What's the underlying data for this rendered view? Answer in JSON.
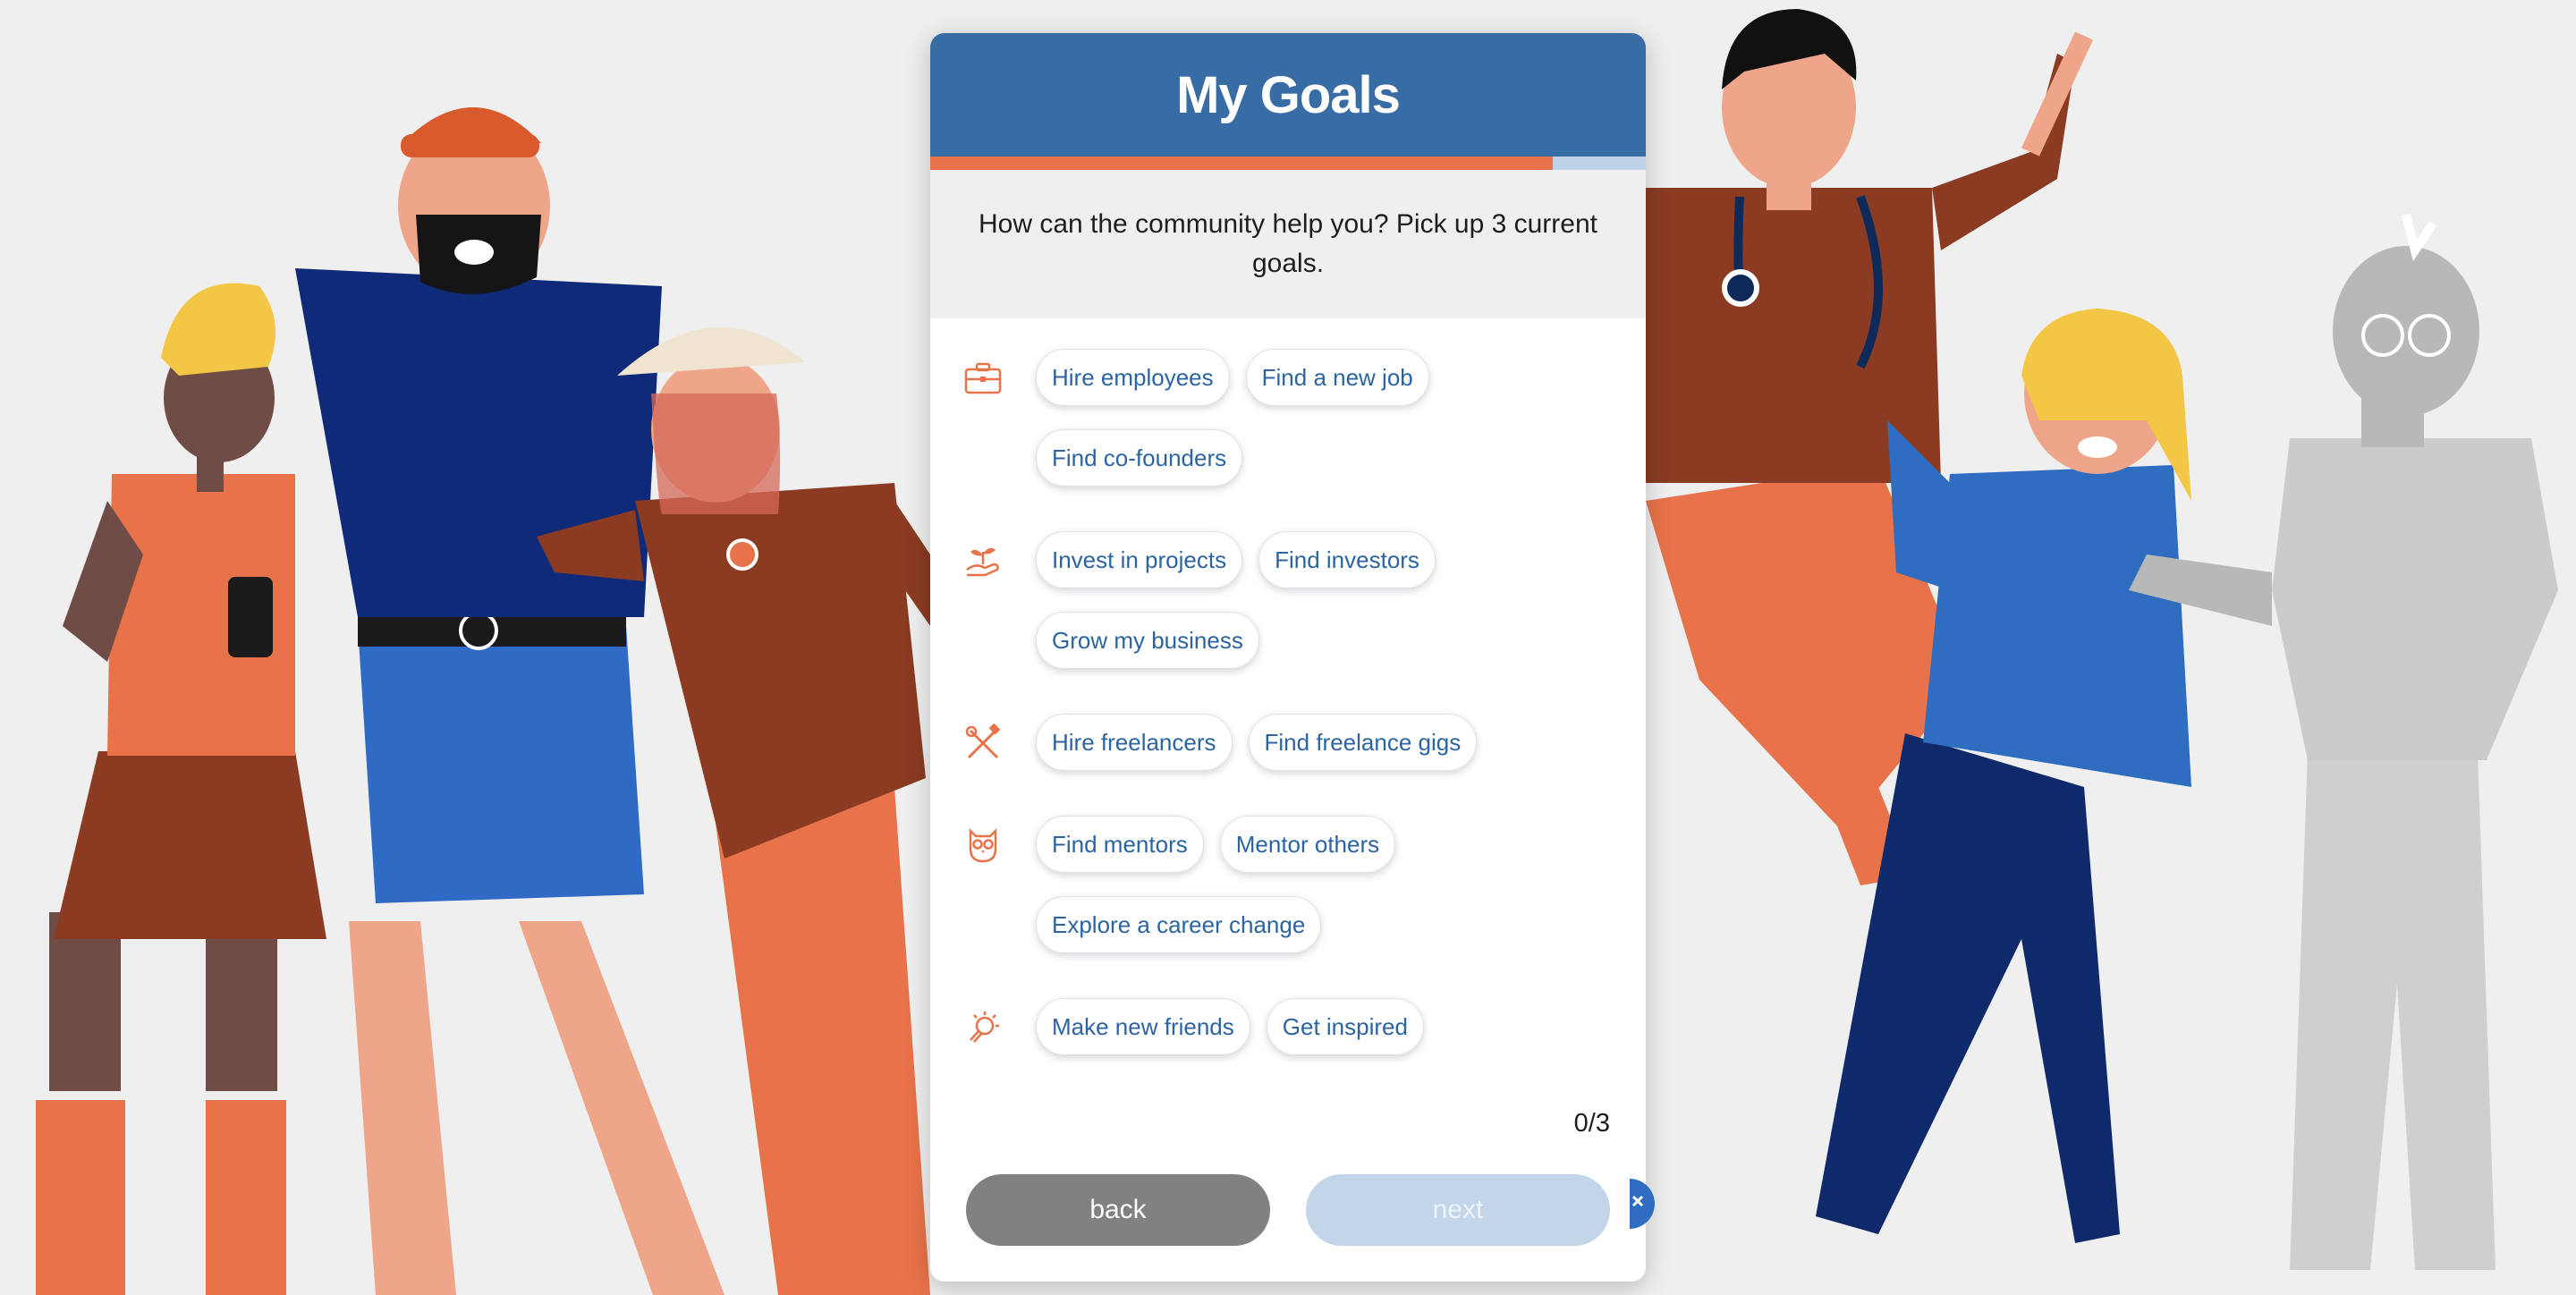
{
  "header": {
    "title": "My Goals"
  },
  "progress": {
    "fraction": 0.87
  },
  "question": "How can the community help you? Pick up 3 current goals.",
  "groups": [
    {
      "icon": "briefcase-icon",
      "chips": [
        "Hire employees",
        "Find a new job",
        "Find co-founders"
      ]
    },
    {
      "icon": "seedling-hand-icon",
      "chips": [
        "Invest in projects",
        "Find investors",
        "Grow my business"
      ]
    },
    {
      "icon": "tools-icon",
      "chips": [
        "Hire freelancers",
        "Find freelance gigs"
      ]
    },
    {
      "icon": "owl-icon",
      "chips": [
        "Find mentors",
        "Mentor others",
        "Explore a career change"
      ]
    },
    {
      "icon": "lightbulb-icon",
      "chips": [
        "Make new friends",
        "Get inspired"
      ]
    }
  ],
  "counter": "0/3",
  "buttons": {
    "back": "back",
    "next": "next"
  },
  "colors": {
    "accent": "#376ca4",
    "progress": "#e8734a",
    "chip_text": "#2c64a2"
  }
}
